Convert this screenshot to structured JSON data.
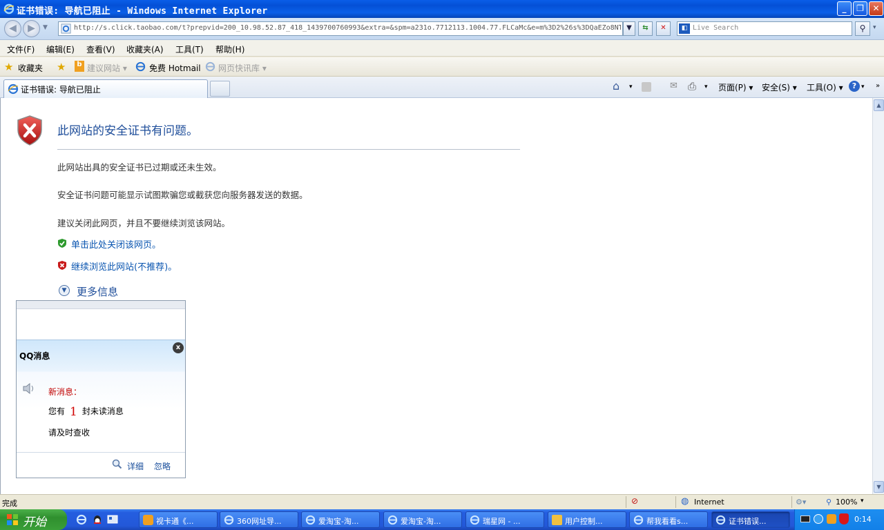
{
  "window": {
    "title": "证书错误: 导航已阻止 - Windows Internet Explorer",
    "minimize": "_",
    "maximize": "❐",
    "close": "✕"
  },
  "address": {
    "url": "http://s.click.taobao.com/t?prepvid=200_10.98.52.87_418_1439700760993&extra=&spm=a231o.7712113.1004.77.FLCaMc&e=m%3D2%26s%3DQaEZo8NT",
    "search_placeholder": "Live Search"
  },
  "menu": [
    "文件(F)",
    "编辑(E)",
    "查看(V)",
    "收藏夹(A)",
    "工具(T)",
    "帮助(H)"
  ],
  "favbar": {
    "favorites": "收藏夹",
    "suggested": "建议网站 ▾",
    "hotmail": "免费 Hotmail",
    "webslice": "网页快讯库 ▾"
  },
  "tab": {
    "label": "证书错误: 导航已阻止"
  },
  "cmdbar": {
    "page": "页面(P) ▾",
    "safety": "安全(S) ▾",
    "tools": "工具(O) ▾"
  },
  "cert_error": {
    "heading": "此网站的安全证书有问题。",
    "p1": "此网站出具的安全证书已过期或还未生效。",
    "p2": "安全证书问题可能显示试图欺骗您或截获您向服务器发送的数据。",
    "p3": "建议关闭此网页，并且不要继续浏览该网站。",
    "close_link": "单击此处关闭该网页。",
    "continue_link": "继续浏览此网站(不推荐)。",
    "more_info": "更多信息"
  },
  "qq": {
    "title": "QQ消息",
    "new_label": "新消息：",
    "you_have": "您有",
    "count": "1",
    "unread": "封未读消息",
    "check": "请及时查收",
    "detail": "详细",
    "ignore": "忽略",
    "close": "x"
  },
  "status": {
    "text": "完成",
    "zone": "Internet",
    "zoom": "100%"
  },
  "taskbar": {
    "start": "开始",
    "tasks": [
      "视卡通《...",
      "360网址导...",
      "爱淘宝-淘...",
      "爱淘宝-淘...",
      "瑞星网 - ...",
      "用户控制...",
      "帮我看看s...",
      "证书错误..."
    ],
    "clock": "0:14"
  },
  "colors": {
    "heading_blue": "#1f4e9a",
    "link_blue": "#0a55b0",
    "xp_title_blue": "#0a5ee8",
    "start_green": "#3a9f38"
  }
}
